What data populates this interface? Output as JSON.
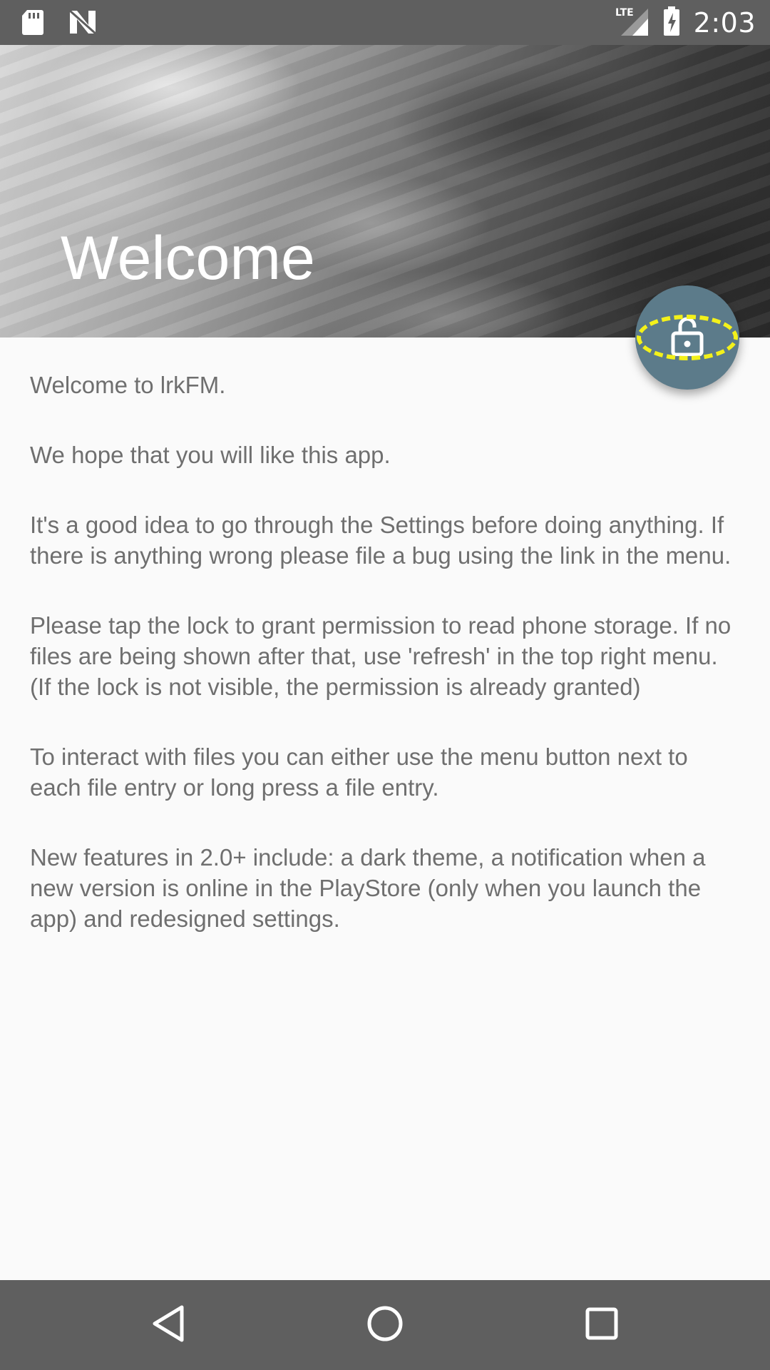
{
  "status_bar": {
    "time": "2:03",
    "network": "LTE",
    "icons": [
      "sd-card-icon",
      "n-icon",
      "lte-signal-icon",
      "battery-charging-icon"
    ]
  },
  "header": {
    "title": "Welcome"
  },
  "fab": {
    "icon": "lock-open-icon",
    "highlight_color": "#f3f11a",
    "color": "#5c7b8a"
  },
  "content": {
    "paragraphs": [
      "Welcome to lrkFM.",
      "We hope that you will like this app.",
      "It's a good idea to go through the Settings before doing anything. If there is anything wrong please file a bug using the link in the menu.",
      "Please tap the lock to grant permission to read phone storage. If no files are being shown after that, use 'refresh' in the top right menu. (If the lock is not visible, the permission is already granted)",
      "To interact with files you can either use the menu button next to each file entry or long press a file entry.",
      "New features in 2.0+ include: a dark theme, a notification when a new version is online in the PlayStore (only when you launch the app) and redesigned settings."
    ]
  },
  "nav_bar": {
    "buttons": [
      "back-icon",
      "home-icon",
      "recents-icon"
    ]
  }
}
